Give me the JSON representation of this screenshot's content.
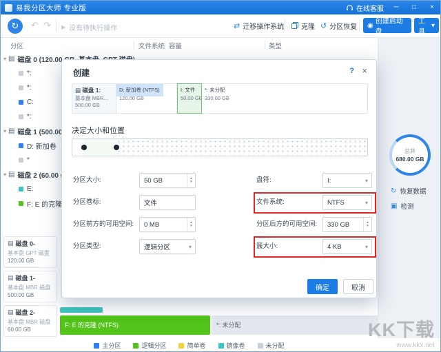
{
  "colors": {
    "accent": "#1b7ce4",
    "highlight": "#e02525"
  },
  "icons": {
    "refresh": "↻",
    "undo": "↶",
    "redo": "↷",
    "play": "▶",
    "migrate": "⇄",
    "recover": "↺",
    "boot": "◉",
    "caret": "▾",
    "help": "?",
    "close": "×",
    "minimize": "─",
    "maximize": "□",
    "disk": "▤",
    "up": "▲",
    "down": "▼",
    "restore": "↻",
    "detect": "▣"
  },
  "titlebar": {
    "title": "易我分区大师 专业版",
    "online_service": "在线客服"
  },
  "toolbar": {
    "pending": "没有待执行操作",
    "migrate": "迁移操作系统",
    "clone": "克隆",
    "recover": "分区恢复",
    "bootdisk": "创建启动盘",
    "tools": "工具"
  },
  "columns": {
    "partition": "分区",
    "filesystem": "文件系统",
    "capacity": "容量",
    "type": "类型"
  },
  "tree": {
    "items": [
      {
        "label": "磁盘 0 (120.00 GB, 基本盘, GPT 磁盘)",
        "kind": "disk"
      },
      {
        "label": "*:",
        "kind": "part",
        "color": "#c9cfd8"
      },
      {
        "label": "*:",
        "kind": "part",
        "color": "#c9cfd8"
      },
      {
        "label": "C:",
        "kind": "part",
        "color": "#2f7ef7"
      },
      {
        "label": "*:",
        "kind": "part",
        "color": "#c9cfd8"
      },
      {
        "label": "磁盘 1 (500.00 GB, 基本盘, MBR 磁盘)",
        "kind": "disk"
      },
      {
        "label": "D: 新加卷",
        "kind": "part",
        "color": "#2f7ef7"
      },
      {
        "label": "*",
        "kind": "part",
        "color": "#c9cfd8"
      },
      {
        "label": "磁盘 2 (60.00 GB, 基本盘, MBR 磁盘)",
        "kind": "disk"
      },
      {
        "label": "E:",
        "kind": "part",
        "color": "#38c5c9"
      },
      {
        "label": "F: E 的克隆",
        "kind": "part",
        "color": "#52c41a"
      }
    ]
  },
  "disk_cards": [
    {
      "name": "磁盘 0-",
      "sub": "基本盘 GPT 磁盘",
      "size": "120.00 GB"
    },
    {
      "name": "磁盘 1-",
      "sub": "基本盘 MBR 磁盘",
      "size": "500.00 GB"
    },
    {
      "name": "磁盘 2-",
      "sub": "基本盘 MBR 磁盘",
      "size": "60.00 GB"
    }
  ],
  "disk2_strip": {
    "segments": [
      {
        "label": "F: E 的克隆  (NTFS)",
        "color": "#52c41a"
      },
      {
        "label": "*: 未分配",
        "color": "#e4e8ee"
      }
    ]
  },
  "sidebar": {
    "total_label": "总共",
    "total_value": "680.00 GB",
    "actions": [
      {
        "label": "恢复数据"
      },
      {
        "label": "检测"
      }
    ]
  },
  "dialog": {
    "title": "创建",
    "disk": {
      "name": "磁盘 1:",
      "sub": "基本盘 MBR...",
      "size": "500.00 GB"
    },
    "strip": [
      {
        "title": "D: 新加卷 (NTFS)",
        "size": "120.00 GB"
      },
      {
        "title": "I: 文件",
        "size": "50.00 GB"
      },
      {
        "title": "*: 未分配",
        "size": "330.00 GB"
      }
    ],
    "section": "决定大小和位置",
    "form": {
      "size_label": "分区大小:",
      "size_value": "50 GB",
      "letter_label": "盘符:",
      "letter_value": "I:",
      "volume_label": "分区卷标:",
      "volume_value": "文件",
      "fs_label": "文件系统:",
      "fs_value": "NTFS",
      "before_label": "分区前方的可用空间:",
      "before_value": "0 MB",
      "after_label": "分区后方的可用空间:",
      "after_value": "330 GB",
      "type_label": "分区类型:",
      "type_value": "逻辑分区",
      "cluster_label": "簇大小:",
      "cluster_value": "4 KB"
    },
    "ok": "确定",
    "cancel": "取消"
  },
  "legend": [
    {
      "label": "主分区",
      "color": "#2f7ef7"
    },
    {
      "label": "逻辑分区",
      "color": "#52c41a"
    },
    {
      "label": "简单卷",
      "color": "#f5d13f"
    },
    {
      "label": "镜像卷",
      "color": "#38c5c9"
    },
    {
      "label": "未分配",
      "color": "#c9cfd8"
    }
  ],
  "watermark": {
    "title": "KK下载",
    "url": "www.kkx.net"
  }
}
